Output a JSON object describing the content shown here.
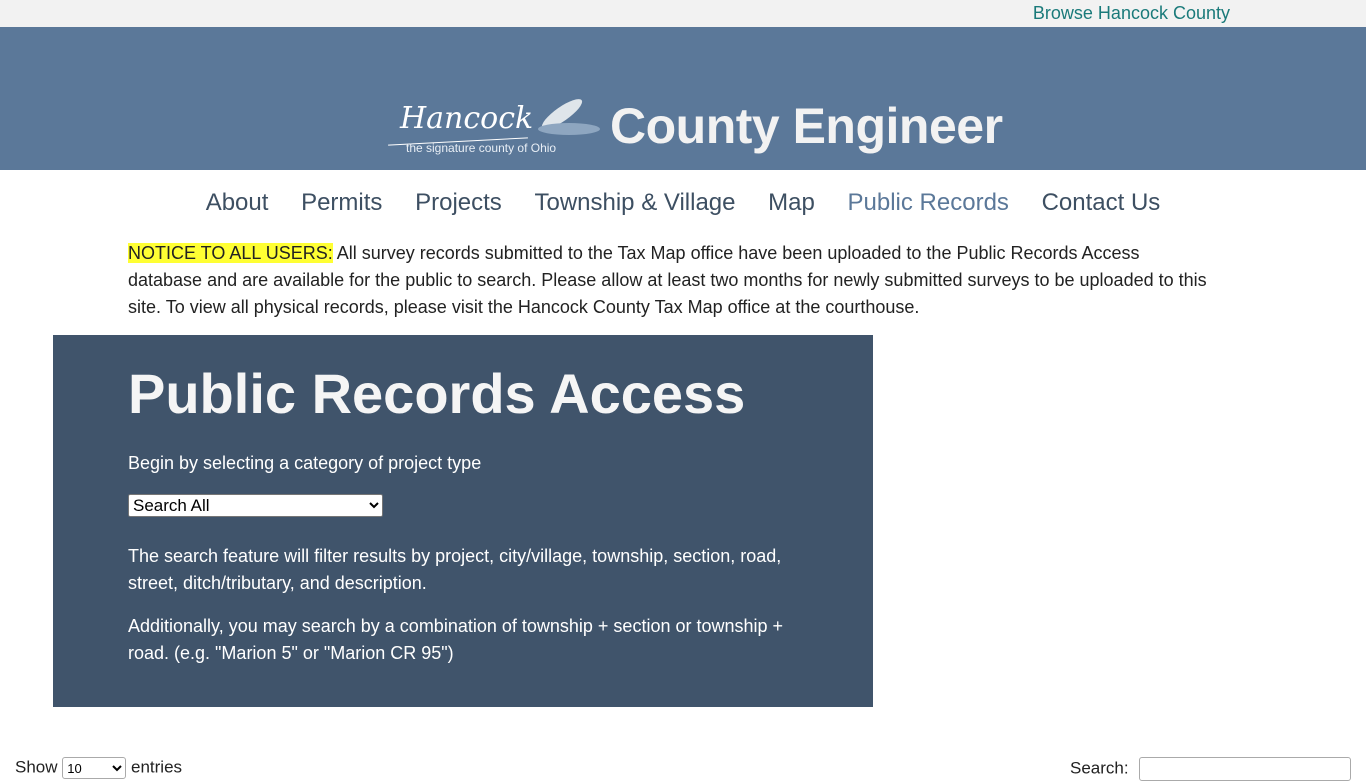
{
  "topbar": {
    "link": "Browse Hancock County"
  },
  "header": {
    "logo_script": "Hancock",
    "logo_tagline": "the signature county of Ohio",
    "title": "County Engineer"
  },
  "nav": [
    {
      "label": "About"
    },
    {
      "label": "Permits"
    },
    {
      "label": "Projects"
    },
    {
      "label": "Township & Village"
    },
    {
      "label": "Map"
    },
    {
      "label": "Public Records",
      "active": true
    },
    {
      "label": "Contact Us"
    }
  ],
  "notice": {
    "label": "NOTICE TO ALL USERS:",
    "text": " All survey records submitted to the Tax Map office have been uploaded to the Public Records Access database and are available for the public to search. Please allow at least two months for newly submitted surveys to be uploaded to this site. To view all physical records, please visit the Hancock County Tax Map office at the courthouse.",
    "highlight": "#ffff33"
  },
  "panel": {
    "title": "Public Records Access",
    "instruction": "Begin by selecting a category of project type",
    "category_selected": "Search All",
    "para1": "The search feature will filter results by project, city/village, township, section, road, street, ditch/tributary, and description.",
    "para2": "Additionally, you may search by a combination of township + section or township + road. (e.g. \"Marion 5\" or \"Marion CR 95\")"
  },
  "table": {
    "show_label": "Show",
    "length_value": "10",
    "entries_label": "entries",
    "search_label": "Search:",
    "search_value": ""
  }
}
